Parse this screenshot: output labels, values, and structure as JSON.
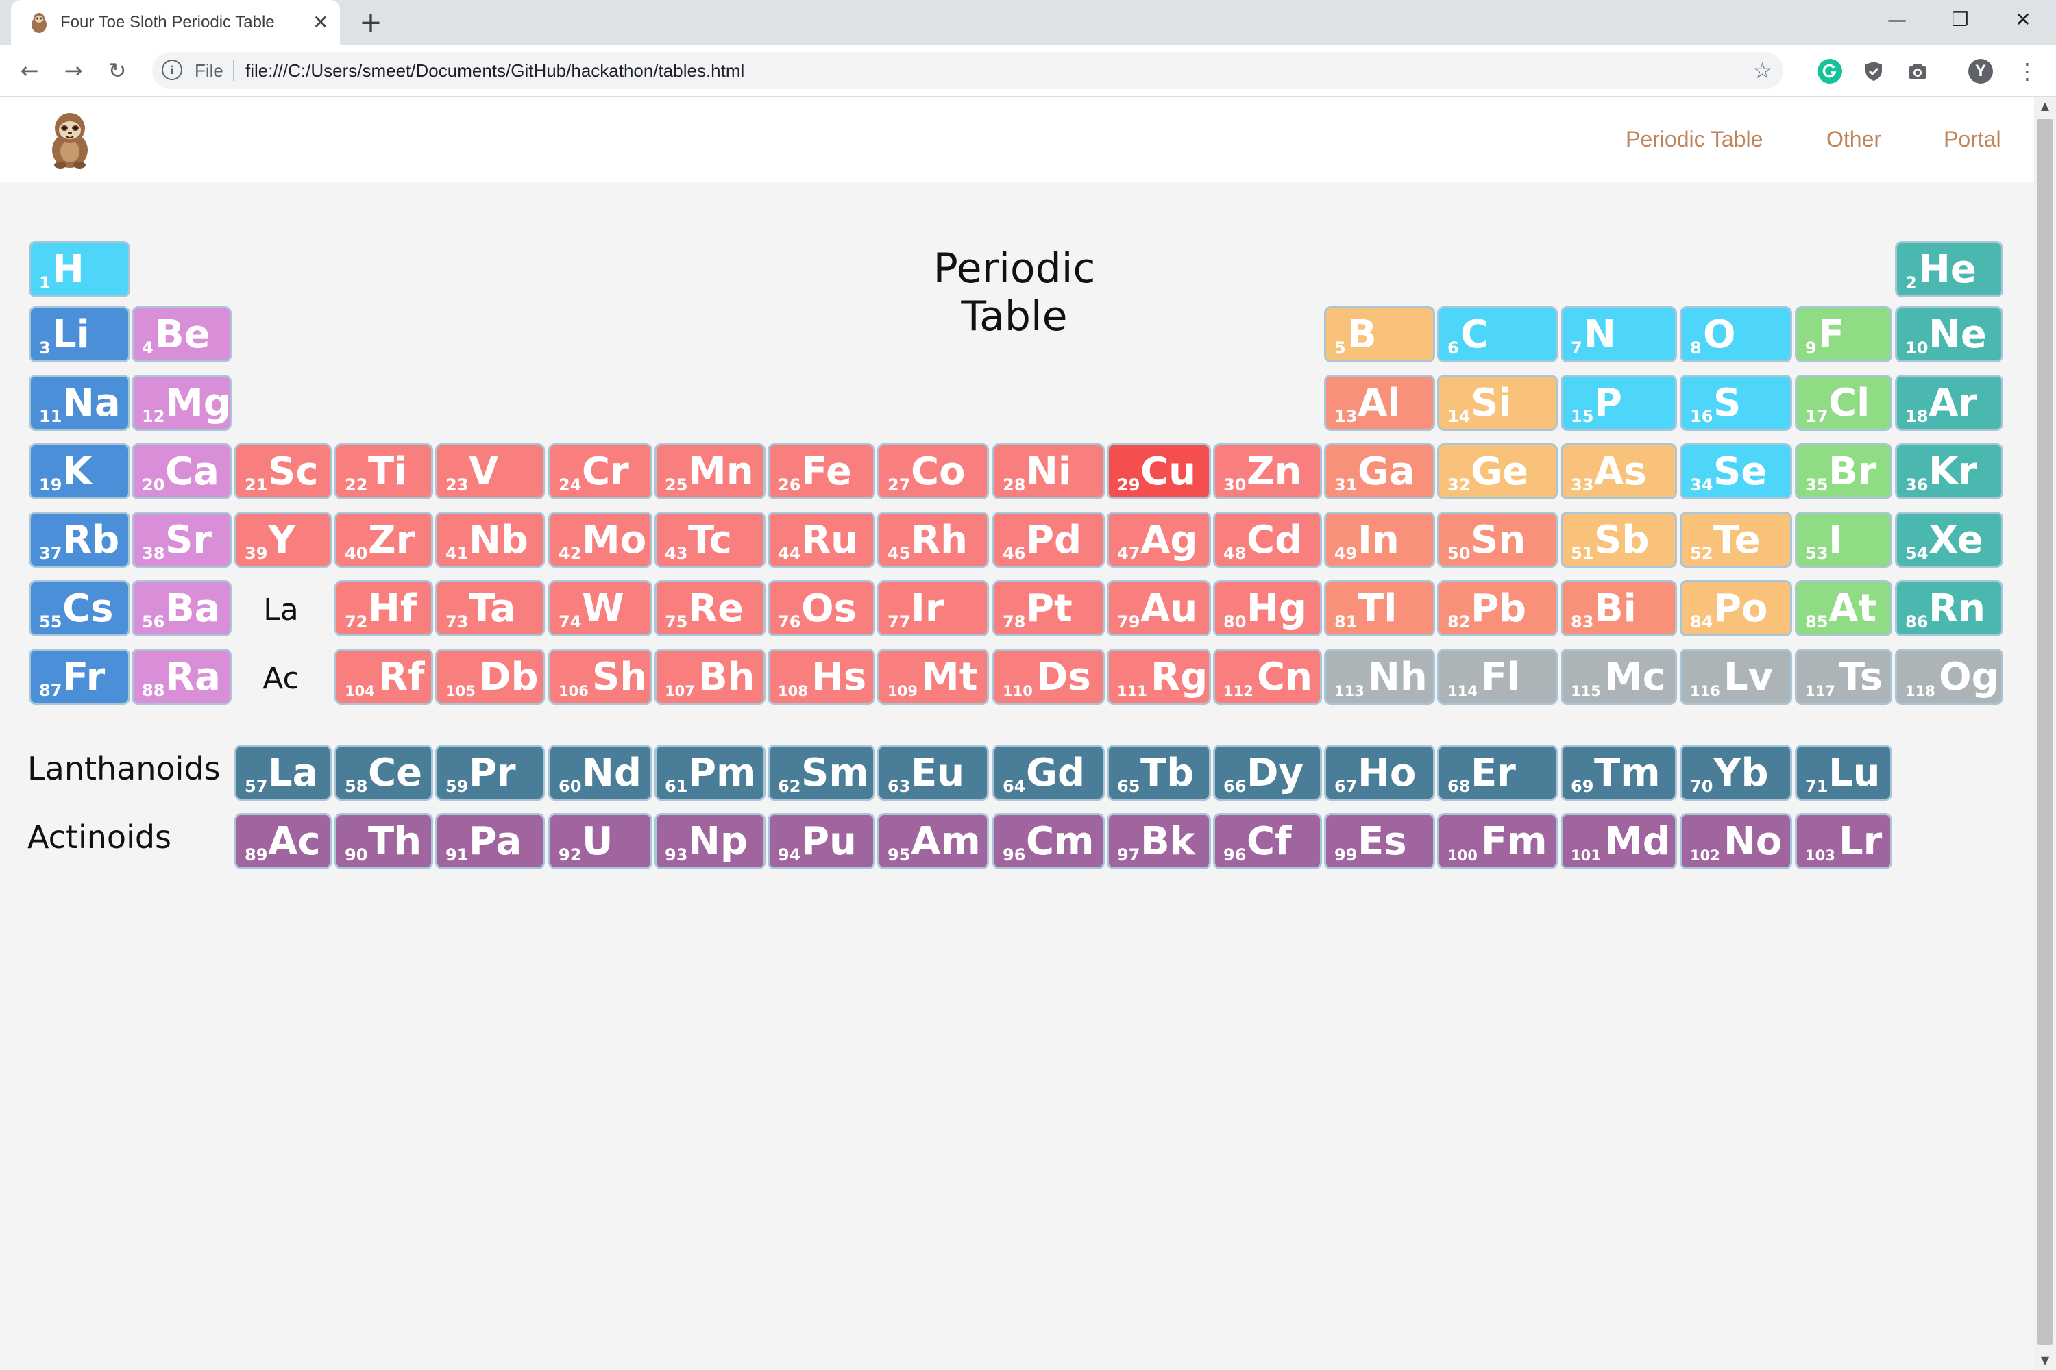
{
  "browser": {
    "tab_title": "Four Toe Sloth Periodic Table",
    "tab_favicon": "sloth-icon",
    "tab_close": "✕",
    "new_tab": "+",
    "minimize": "—",
    "restore": "❐",
    "close": "✕",
    "back": "←",
    "forward": "→",
    "reload": "↻",
    "info": "i",
    "scheme": "File",
    "url": "file:///C:/Users/smeet/Documents/GitHub/hackathon/tables.html",
    "star": "☆",
    "menu": "⋮",
    "profile": "Y"
  },
  "header": {
    "nav": [
      {
        "label": "Periodic Table"
      },
      {
        "label": "Other"
      },
      {
        "label": "Portal"
      }
    ]
  },
  "main": {
    "title": "Periodic Table",
    "lanthanide_placeholder": "La",
    "actinide_placeholder": "Ac",
    "lanthanoids_label": "Lanthanoids",
    "actinoids_label": "Actinoids"
  },
  "colors": {
    "alkali": "#4a8fd8",
    "alkaline": "#d98ed8",
    "transition": "#f97f7e",
    "highlight": "#f54e4e",
    "post_transition": "#f8907a",
    "metalloid": "#f9c27a",
    "nonmetal": "#4ed6fa",
    "halogen": "#8fdc85",
    "noble": "#4bb8b0",
    "unknown": "#acb4b8",
    "lanthanide": "#4a7d97",
    "actinide": "#a0649f"
  },
  "elements": [
    {
      "z": "1",
      "sym": "H",
      "row": 1,
      "col": 1,
      "cat": "nonmetal"
    },
    {
      "z": "2",
      "sym": "He",
      "row": 1,
      "col": 18,
      "cat": "noble"
    },
    {
      "z": "3",
      "sym": "Li",
      "row": 2,
      "col": 1,
      "cat": "alkali"
    },
    {
      "z": "4",
      "sym": "Be",
      "row": 2,
      "col": 2,
      "cat": "alkaline"
    },
    {
      "z": "5",
      "sym": "B",
      "row": 2,
      "col": 13,
      "cat": "metalloid"
    },
    {
      "z": "6",
      "sym": "C",
      "row": 2,
      "col": 14,
      "cat": "nonmetal"
    },
    {
      "z": "7",
      "sym": "N",
      "row": 2,
      "col": 15,
      "cat": "nonmetal"
    },
    {
      "z": "8",
      "sym": "O",
      "row": 2,
      "col": 16,
      "cat": "nonmetal"
    },
    {
      "z": "9",
      "sym": "F",
      "row": 2,
      "col": 17,
      "cat": "halogen"
    },
    {
      "z": "10",
      "sym": "Ne",
      "row": 2,
      "col": 18,
      "cat": "noble"
    },
    {
      "z": "11",
      "sym": "Na",
      "row": 3,
      "col": 1,
      "cat": "alkali"
    },
    {
      "z": "12",
      "sym": "Mg",
      "row": 3,
      "col": 2,
      "cat": "alkaline"
    },
    {
      "z": "13",
      "sym": "Al",
      "row": 3,
      "col": 13,
      "cat": "post_transition"
    },
    {
      "z": "14",
      "sym": "Si",
      "row": 3,
      "col": 14,
      "cat": "metalloid"
    },
    {
      "z": "15",
      "sym": "P",
      "row": 3,
      "col": 15,
      "cat": "nonmetal"
    },
    {
      "z": "16",
      "sym": "S",
      "row": 3,
      "col": 16,
      "cat": "nonmetal"
    },
    {
      "z": "17",
      "sym": "Cl",
      "row": 3,
      "col": 17,
      "cat": "halogen"
    },
    {
      "z": "18",
      "sym": "Ar",
      "row": 3,
      "col": 18,
      "cat": "noble"
    },
    {
      "z": "19",
      "sym": "K",
      "row": 4,
      "col": 1,
      "cat": "alkali"
    },
    {
      "z": "20",
      "sym": "Ca",
      "row": 4,
      "col": 2,
      "cat": "alkaline"
    },
    {
      "z": "21",
      "sym": "Sc",
      "row": 4,
      "col": 3,
      "cat": "transition"
    },
    {
      "z": "22",
      "sym": "Ti",
      "row": 4,
      "col": 4,
      "cat": "transition"
    },
    {
      "z": "23",
      "sym": "V",
      "row": 4,
      "col": 5,
      "cat": "transition"
    },
    {
      "z": "24",
      "sym": "Cr",
      "row": 4,
      "col": 6,
      "cat": "transition"
    },
    {
      "z": "25",
      "sym": "Mn",
      "row": 4,
      "col": 7,
      "cat": "transition"
    },
    {
      "z": "26",
      "sym": "Fe",
      "row": 4,
      "col": 8,
      "cat": "transition"
    },
    {
      "z": "27",
      "sym": "Co",
      "row": 4,
      "col": 9,
      "cat": "transition"
    },
    {
      "z": "28",
      "sym": "Ni",
      "row": 4,
      "col": 10,
      "cat": "transition"
    },
    {
      "z": "29",
      "sym": "Cu",
      "row": 4,
      "col": 11,
      "cat": "highlight"
    },
    {
      "z": "30",
      "sym": "Zn",
      "row": 4,
      "col": 12,
      "cat": "transition"
    },
    {
      "z": "31",
      "sym": "Ga",
      "row": 4,
      "col": 13,
      "cat": "post_transition"
    },
    {
      "z": "32",
      "sym": "Ge",
      "row": 4,
      "col": 14,
      "cat": "metalloid"
    },
    {
      "z": "33",
      "sym": "As",
      "row": 4,
      "col": 15,
      "cat": "metalloid"
    },
    {
      "z": "34",
      "sym": "Se",
      "row": 4,
      "col": 16,
      "cat": "nonmetal"
    },
    {
      "z": "35",
      "sym": "Br",
      "row": 4,
      "col": 17,
      "cat": "halogen"
    },
    {
      "z": "36",
      "sym": "Kr",
      "row": 4,
      "col": 18,
      "cat": "noble"
    },
    {
      "z": "37",
      "sym": "Rb",
      "row": 5,
      "col": 1,
      "cat": "alkali"
    },
    {
      "z": "38",
      "sym": "Sr",
      "row": 5,
      "col": 2,
      "cat": "alkaline"
    },
    {
      "z": "39",
      "sym": "Y",
      "row": 5,
      "col": 3,
      "cat": "transition"
    },
    {
      "z": "40",
      "sym": "Zr",
      "row": 5,
      "col": 4,
      "cat": "transition"
    },
    {
      "z": "41",
      "sym": "Nb",
      "row": 5,
      "col": 5,
      "cat": "transition"
    },
    {
      "z": "42",
      "sym": "Mo",
      "row": 5,
      "col": 6,
      "cat": "transition"
    },
    {
      "z": "43",
      "sym": "Tc",
      "row": 5,
      "col": 7,
      "cat": "transition"
    },
    {
      "z": "44",
      "sym": "Ru",
      "row": 5,
      "col": 8,
      "cat": "transition"
    },
    {
      "z": "45",
      "sym": "Rh",
      "row": 5,
      "col": 9,
      "cat": "transition"
    },
    {
      "z": "46",
      "sym": "Pd",
      "row": 5,
      "col": 10,
      "cat": "transition"
    },
    {
      "z": "47",
      "sym": "Ag",
      "row": 5,
      "col": 11,
      "cat": "transition"
    },
    {
      "z": "48",
      "sym": "Cd",
      "row": 5,
      "col": 12,
      "cat": "transition"
    },
    {
      "z": "49",
      "sym": "In",
      "row": 5,
      "col": 13,
      "cat": "post_transition"
    },
    {
      "z": "50",
      "sym": "Sn",
      "row": 5,
      "col": 14,
      "cat": "post_transition"
    },
    {
      "z": "51",
      "sym": "Sb",
      "row": 5,
      "col": 15,
      "cat": "metalloid"
    },
    {
      "z": "52",
      "sym": "Te",
      "row": 5,
      "col": 16,
      "cat": "metalloid"
    },
    {
      "z": "53",
      "sym": "I",
      "row": 5,
      "col": 17,
      "cat": "halogen"
    },
    {
      "z": "54",
      "sym": "Xe",
      "row": 5,
      "col": 18,
      "cat": "noble"
    },
    {
      "z": "55",
      "sym": "Cs",
      "row": 6,
      "col": 1,
      "cat": "alkali"
    },
    {
      "z": "56",
      "sym": "Ba",
      "row": 6,
      "col": 2,
      "cat": "alkaline"
    },
    {
      "z": "72",
      "sym": "Hf",
      "row": 6,
      "col": 4,
      "cat": "transition"
    },
    {
      "z": "73",
      "sym": "Ta",
      "row": 6,
      "col": 5,
      "cat": "transition"
    },
    {
      "z": "74",
      "sym": "W",
      "row": 6,
      "col": 6,
      "cat": "transition"
    },
    {
      "z": "75",
      "sym": "Re",
      "row": 6,
      "col": 7,
      "cat": "transition"
    },
    {
      "z": "76",
      "sym": "Os",
      "row": 6,
      "col": 8,
      "cat": "transition"
    },
    {
      "z": "77",
      "sym": "Ir",
      "row": 6,
      "col": 9,
      "cat": "transition"
    },
    {
      "z": "78",
      "sym": "Pt",
      "row": 6,
      "col": 10,
      "cat": "transition"
    },
    {
      "z": "79",
      "sym": "Au",
      "row": 6,
      "col": 11,
      "cat": "transition"
    },
    {
      "z": "80",
      "sym": "Hg",
      "row": 6,
      "col": 12,
      "cat": "transition"
    },
    {
      "z": "81",
      "sym": "Tl",
      "row": 6,
      "col": 13,
      "cat": "post_transition"
    },
    {
      "z": "82",
      "sym": "Pb",
      "row": 6,
      "col": 14,
      "cat": "post_transition"
    },
    {
      "z": "83",
      "sym": "Bi",
      "row": 6,
      "col": 15,
      "cat": "post_transition"
    },
    {
      "z": "84",
      "sym": "Po",
      "row": 6,
      "col": 16,
      "cat": "metalloid"
    },
    {
      "z": "85",
      "sym": "At",
      "row": 6,
      "col": 17,
      "cat": "halogen"
    },
    {
      "z": "86",
      "sym": "Rn",
      "row": 6,
      "col": 18,
      "cat": "noble"
    },
    {
      "z": "87",
      "sym": "Fr",
      "row": 7,
      "col": 1,
      "cat": "alkali"
    },
    {
      "z": "88",
      "sym": "Ra",
      "row": 7,
      "col": 2,
      "cat": "alkaline"
    },
    {
      "z": "104",
      "sym": "Rf",
      "row": 7,
      "col": 4,
      "cat": "transition"
    },
    {
      "z": "105",
      "sym": "Db",
      "row": 7,
      "col": 5,
      "cat": "transition"
    },
    {
      "z": "106",
      "sym": "Sh",
      "row": 7,
      "col": 6,
      "cat": "transition"
    },
    {
      "z": "107",
      "sym": "Bh",
      "row": 7,
      "col": 7,
      "cat": "transition"
    },
    {
      "z": "108",
      "sym": "Hs",
      "row": 7,
      "col": 8,
      "cat": "transition"
    },
    {
      "z": "109",
      "sym": "Mt",
      "row": 7,
      "col": 9,
      "cat": "transition"
    },
    {
      "z": "110",
      "sym": "Ds",
      "row": 7,
      "col": 10,
      "cat": "transition"
    },
    {
      "z": "111",
      "sym": "Rg",
      "row": 7,
      "col": 11,
      "cat": "transition"
    },
    {
      "z": "112",
      "sym": "Cn",
      "row": 7,
      "col": 12,
      "cat": "transition"
    },
    {
      "z": "113",
      "sym": "Nh",
      "row": 7,
      "col": 13,
      "cat": "unknown"
    },
    {
      "z": "114",
      "sym": "Fl",
      "row": 7,
      "col": 14,
      "cat": "unknown"
    },
    {
      "z": "115",
      "sym": "Mc",
      "row": 7,
      "col": 15,
      "cat": "unknown"
    },
    {
      "z": "116",
      "sym": "Lv",
      "row": 7,
      "col": 16,
      "cat": "unknown"
    },
    {
      "z": "117",
      "sym": "Ts",
      "row": 7,
      "col": 17,
      "cat": "unknown"
    },
    {
      "z": "118",
      "sym": "Og",
      "row": 7,
      "col": 18,
      "cat": "unknown"
    },
    {
      "z": "57",
      "sym": "La",
      "row": 8,
      "col": 3,
      "cat": "lanthanide"
    },
    {
      "z": "58",
      "sym": "Ce",
      "row": 8,
      "col": 4,
      "cat": "lanthanide"
    },
    {
      "z": "59",
      "sym": "Pr",
      "row": 8,
      "col": 5,
      "cat": "lanthanide"
    },
    {
      "z": "60",
      "sym": "Nd",
      "row": 8,
      "col": 6,
      "cat": "lanthanide"
    },
    {
      "z": "61",
      "sym": "Pm",
      "row": 8,
      "col": 7,
      "cat": "lanthanide"
    },
    {
      "z": "62",
      "sym": "Sm",
      "row": 8,
      "col": 8,
      "cat": "lanthanide"
    },
    {
      "z": "63",
      "sym": "Eu",
      "row": 8,
      "col": 9,
      "cat": "lanthanide"
    },
    {
      "z": "64",
      "sym": "Gd",
      "row": 8,
      "col": 10,
      "cat": "lanthanide"
    },
    {
      "z": "65",
      "sym": "Tb",
      "row": 8,
      "col": 11,
      "cat": "lanthanide"
    },
    {
      "z": "66",
      "sym": "Dy",
      "row": 8,
      "col": 12,
      "cat": "lanthanide"
    },
    {
      "z": "67",
      "sym": "Ho",
      "row": 8,
      "col": 13,
      "cat": "lanthanide"
    },
    {
      "z": "68",
      "sym": "Er",
      "row": 8,
      "col": 14,
      "cat": "lanthanide"
    },
    {
      "z": "69",
      "sym": "Tm",
      "row": 8,
      "col": 15,
      "cat": "lanthanide"
    },
    {
      "z": "70",
      "sym": "Yb",
      "row": 8,
      "col": 16,
      "cat": "lanthanide"
    },
    {
      "z": "71",
      "sym": "Lu",
      "row": 8,
      "col": 17,
      "cat": "lanthanide"
    },
    {
      "z": "89",
      "sym": "Ac",
      "row": 9,
      "col": 3,
      "cat": "actinide"
    },
    {
      "z": "90",
      "sym": "Th",
      "row": 9,
      "col": 4,
      "cat": "actinide"
    },
    {
      "z": "91",
      "sym": "Pa",
      "row": 9,
      "col": 5,
      "cat": "actinide"
    },
    {
      "z": "92",
      "sym": "U",
      "row": 9,
      "col": 6,
      "cat": "actinide"
    },
    {
      "z": "93",
      "sym": "Np",
      "row": 9,
      "col": 7,
      "cat": "actinide"
    },
    {
      "z": "94",
      "sym": "Pu",
      "row": 9,
      "col": 8,
      "cat": "actinide"
    },
    {
      "z": "95",
      "sym": "Am",
      "row": 9,
      "col": 9,
      "cat": "actinide"
    },
    {
      "z": "96",
      "sym": "Cm",
      "row": 9,
      "col": 10,
      "cat": "actinide"
    },
    {
      "z": "97",
      "sym": "Bk",
      "row": 9,
      "col": 11,
      "cat": "actinide"
    },
    {
      "z": "96",
      "sym": "Cf",
      "row": 9,
      "col": 12,
      "cat": "actinide"
    },
    {
      "z": "99",
      "sym": "Es",
      "row": 9,
      "col": 13,
      "cat": "actinide"
    },
    {
      "z": "100",
      "sym": "Fm",
      "row": 9,
      "col": 14,
      "cat": "actinide"
    },
    {
      "z": "101",
      "sym": "Md",
      "row": 9,
      "col": 15,
      "cat": "actinide"
    },
    {
      "z": "102",
      "sym": "No",
      "row": 9,
      "col": 16,
      "cat": "actinide"
    },
    {
      "z": "103",
      "sym": "Lr",
      "row": 9,
      "col": 17,
      "cat": "actinide"
    }
  ]
}
